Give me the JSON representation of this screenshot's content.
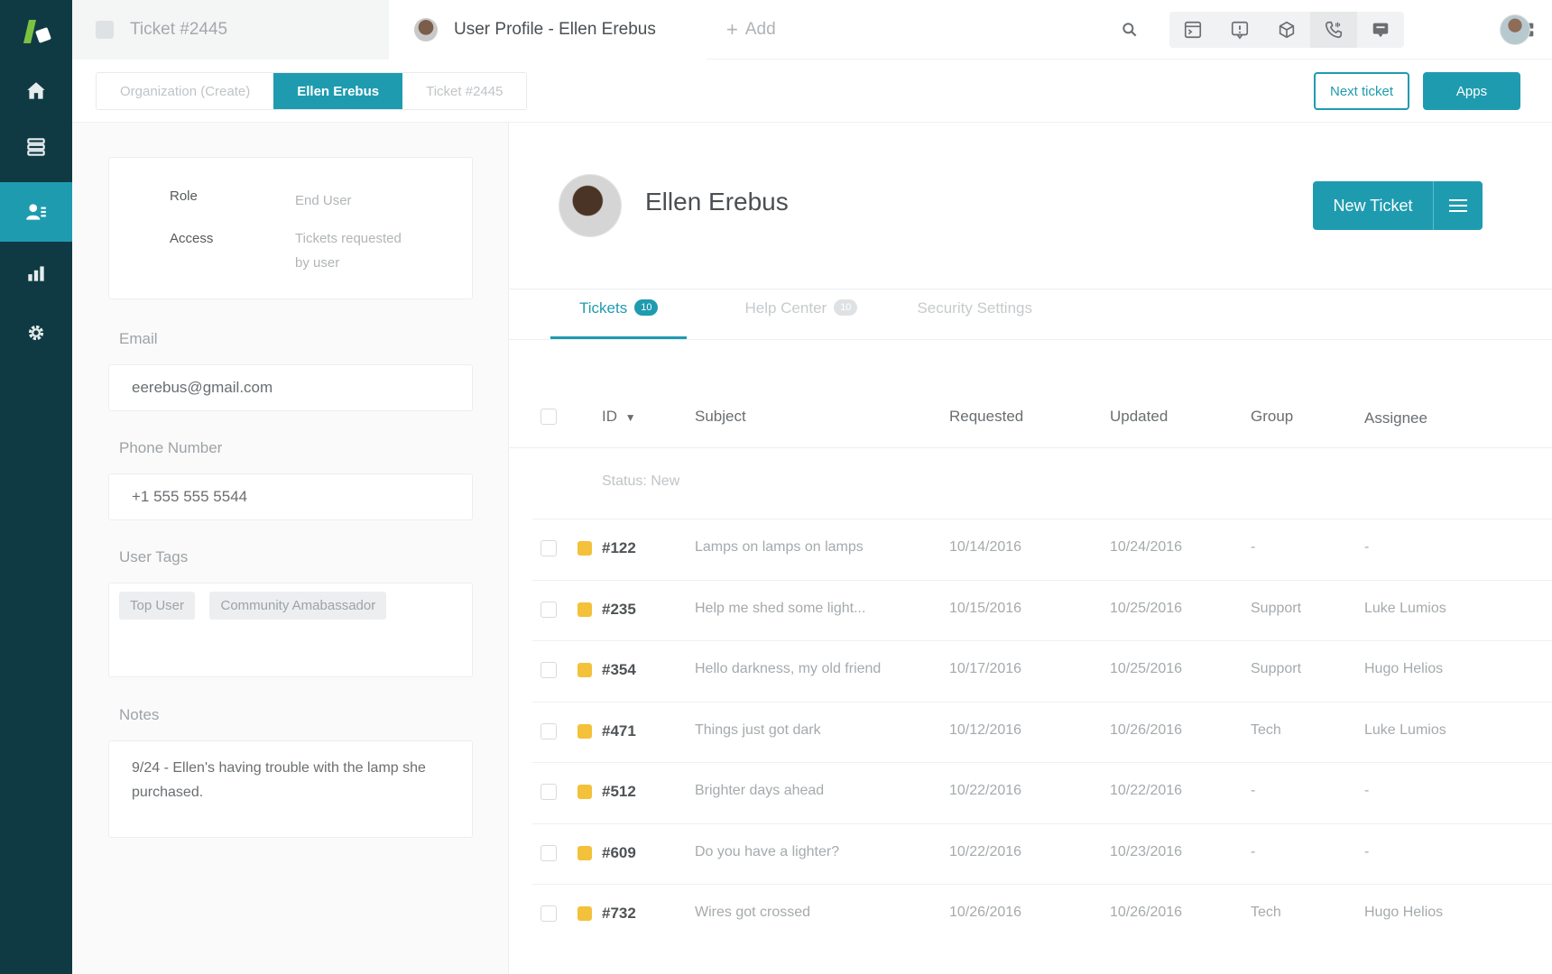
{
  "sidebar": {
    "items": [
      {
        "icon": "home-icon"
      },
      {
        "icon": "views-icon"
      },
      {
        "icon": "customers-icon",
        "active": true
      },
      {
        "icon": "reporting-icon"
      },
      {
        "icon": "settings-gear-icon"
      }
    ]
  },
  "topbar": {
    "tabs": [
      {
        "label": "Ticket #2445"
      },
      {
        "label": "User Profile - Ellen Erebus"
      }
    ],
    "add_label": "Add"
  },
  "subbar": {
    "crumbs": [
      "Organization (Create)",
      "Ellen Erebus",
      "Ticket #2445"
    ],
    "next_ticket_label": "Next ticket",
    "apps_label": "Apps"
  },
  "user_card": {
    "role_label": "Role",
    "role_value": "End User",
    "access_label": "Access",
    "access_value_line1": "Tickets requested",
    "access_value_line2": "by user"
  },
  "fields": {
    "email_label": "Email",
    "email_value": "eerebus@gmail.com",
    "phone_label": "Phone Number",
    "phone_value": "+1 555 555 5544",
    "tags_label": "User Tags",
    "tags": [
      "Top User",
      "Community Amabassador"
    ],
    "notes_label": "Notes",
    "notes_value": "9/24 - Ellen's having trouble with the lamp she purchased."
  },
  "profile": {
    "name": "Ellen Erebus",
    "new_ticket_label": "New Ticket"
  },
  "tabs": [
    {
      "label": "Tickets",
      "count": "10"
    },
    {
      "label": "Help Center",
      "count": "10"
    },
    {
      "label": "Security Settings"
    }
  ],
  "table": {
    "headers": {
      "id": "ID",
      "subject": "Subject",
      "requested": "Requested",
      "updated": "Updated",
      "group": "Group",
      "assignee": "Assignee"
    },
    "status_label": "Status: New",
    "rows": [
      {
        "id": "#122",
        "subject": "Lamps on lamps on lamps",
        "requested": "10/14/2016",
        "updated": "10/24/2016",
        "group": "-",
        "assignee": "-"
      },
      {
        "id": "#235",
        "subject": "Help me shed some light...",
        "requested": "10/15/2016",
        "updated": "10/25/2016",
        "group": "Support",
        "assignee": "Luke Lumios"
      },
      {
        "id": "#354",
        "subject": "Hello darkness, my old friend",
        "requested": "10/17/2016",
        "updated": "10/25/2016",
        "group": "Support",
        "assignee": "Hugo Helios"
      },
      {
        "id": "#471",
        "subject": "Things just got dark",
        "requested": "10/12/2016",
        "updated": "10/26/2016",
        "group": "Tech",
        "assignee": "Luke Lumios"
      },
      {
        "id": "#512",
        "subject": "Brighter days ahead",
        "requested": "10/22/2016",
        "updated": "10/22/2016",
        "group": "-",
        "assignee": "-"
      },
      {
        "id": "#609",
        "subject": "Do you have a lighter?",
        "requested": "10/22/2016",
        "updated": "10/23/2016",
        "group": "-",
        "assignee": "-"
      },
      {
        "id": "#732",
        "subject": "Wires got crossed",
        "requested": "10/26/2016",
        "updated": "10/26/2016",
        "group": "Tech",
        "assignee": "Hugo Helios"
      }
    ]
  },
  "colors": {
    "accent": "#1f9bb0",
    "sidebar": "#0f3a44",
    "new_badge": "#f3c13a"
  }
}
